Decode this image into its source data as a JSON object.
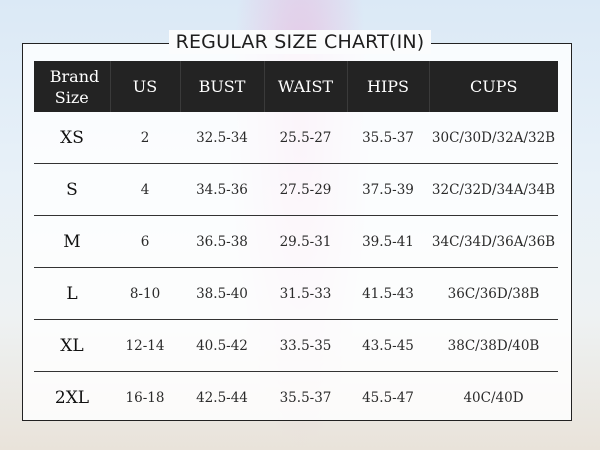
{
  "title": "REGULAR SIZE CHART(IN)",
  "headers": [
    "Brand Size",
    "US",
    "BUST",
    "WAIST",
    "HIPS",
    "CUPS"
  ],
  "rows": [
    [
      "XS",
      "2",
      "32.5-34",
      "25.5-27",
      "35.5-37",
      "30C/30D/32A/32B"
    ],
    [
      "S",
      "4",
      "34.5-36",
      "27.5-29",
      "37.5-39",
      "32C/32D/34A/34B"
    ],
    [
      "M",
      "6",
      "36.5-38",
      "29.5-31",
      "39.5-41",
      "34C/34D/36A/36B"
    ],
    [
      "L",
      "8-10",
      "38.5-40",
      "31.5-33",
      "41.5-43",
      "36C/36D/38B"
    ],
    [
      "XL",
      "12-14",
      "40.5-42",
      "33.5-35",
      "43.5-45",
      "38C/38D/40B"
    ],
    [
      "2XL",
      "16-18",
      "42.5-44",
      "35.5-37",
      "45.5-47",
      "40C/40D"
    ]
  ]
}
